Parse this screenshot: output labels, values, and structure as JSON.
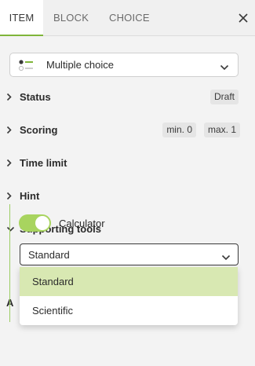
{
  "tabs": [
    {
      "label": "ITEM"
    },
    {
      "label": "BLOCK"
    },
    {
      "label": "CHOICE"
    }
  ],
  "item_type": {
    "label": "Multiple choice",
    "icon": "multiple-choice-icon"
  },
  "sections": [
    {
      "label": "Status",
      "badges": [
        "Draft"
      ]
    },
    {
      "label": "Scoring",
      "badges": [
        "min. 0",
        "max. 1"
      ]
    },
    {
      "label": "Time limit",
      "badges": []
    },
    {
      "label": "Hint",
      "badges": []
    },
    {
      "label": "Supporting tools",
      "expanded": true,
      "badges": []
    }
  ],
  "supporting_tools": {
    "calculator_label": "Calculator",
    "calculator_enabled": true,
    "calculator_type": "Standard",
    "options": [
      "Standard",
      "Scientific"
    ]
  },
  "partial_row_glyph": "A",
  "colors": {
    "accent": "#7fb539",
    "toggle": "#a8d45f",
    "selected_option": "#d8e8b2"
  }
}
